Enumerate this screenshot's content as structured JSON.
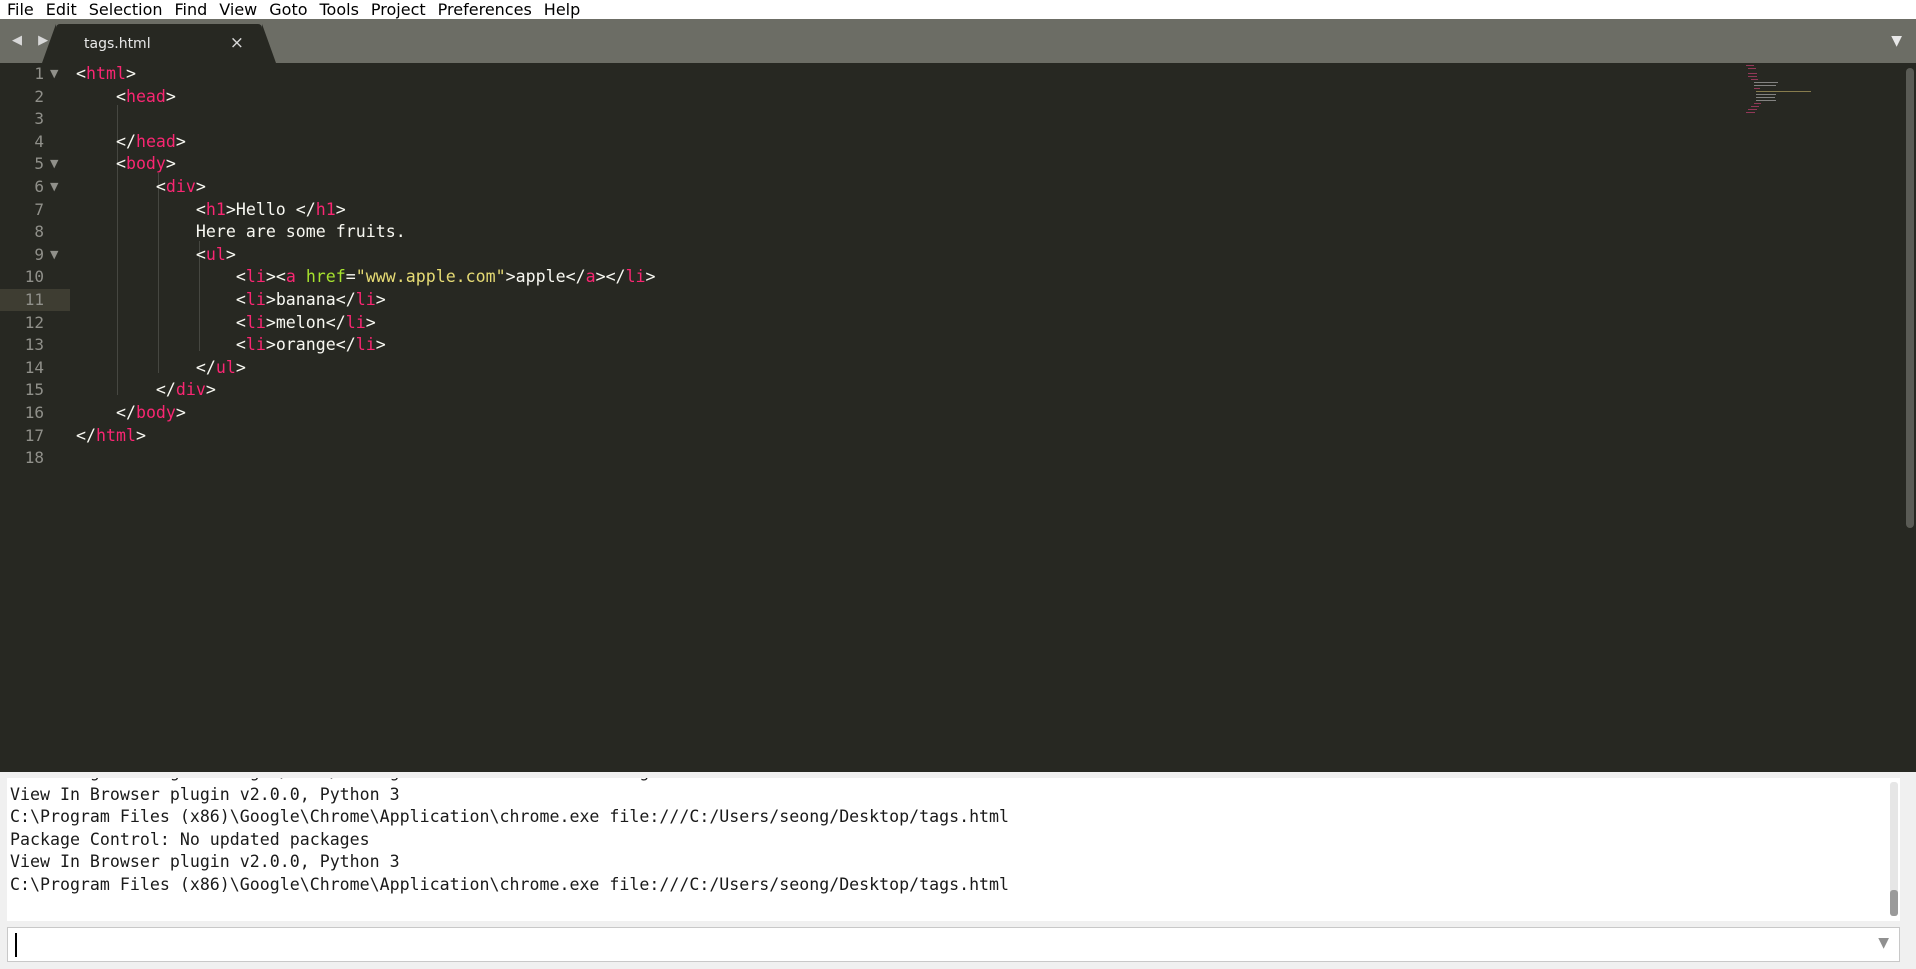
{
  "menu": [
    "File",
    "Edit",
    "Selection",
    "Find",
    "View",
    "Goto",
    "Tools",
    "Project",
    "Preferences",
    "Help"
  ],
  "tab": {
    "label": "tags.html",
    "close": "×"
  },
  "nav": {
    "arrows": "◀ ▶",
    "dropdown": "▼"
  },
  "gutter": {
    "line_numbers": [
      "1",
      "2",
      "3",
      "4",
      "5",
      "6",
      "7",
      "8",
      "9",
      "10",
      "11",
      "12",
      "13",
      "14",
      "15",
      "16",
      "17",
      "18"
    ],
    "fold_marker": "▼",
    "current_line": "11"
  },
  "code_lines": [
    "<html>",
    "    <head>",
    "",
    "    </head>",
    "    <body>",
    "        <div>",
    "            <h1>Hello </h1>",
    "            Here are some fruits.",
    "            <ul>",
    "                <li><a href=\"www.apple.com\">apple</a></li>",
    "                <li>banana</li>",
    "                <li>melon</li>",
    "                <li>orange</li>",
    "            </ul>",
    "        </div>",
    "    </body>",
    "</html>",
    ""
  ],
  "colors": {
    "editor_bg": "#272822",
    "tag": "#f92672",
    "attr": "#a6e22e",
    "string": "#e6db74",
    "text": "#f8f8f2"
  },
  "console": {
    "lines": [
      "Reloading settings Packages/User/Package Control.sublime-settings",
      "View In Browser plugin v2.0.0, Python 3",
      "C:\\Program Files (x86)\\Google\\Chrome\\Application\\chrome.exe file:///C:/Users/seong/Desktop/tags.html",
      "Package Control: No updated packages",
      "View In Browser plugin v2.0.0, Python 3",
      "C:\\Program Files (x86)\\Google\\Chrome\\Application\\chrome.exe file:///C:/Users/seong/Desktop/tags.html"
    ]
  },
  "input": {
    "value": "",
    "dropdown": "▼"
  }
}
